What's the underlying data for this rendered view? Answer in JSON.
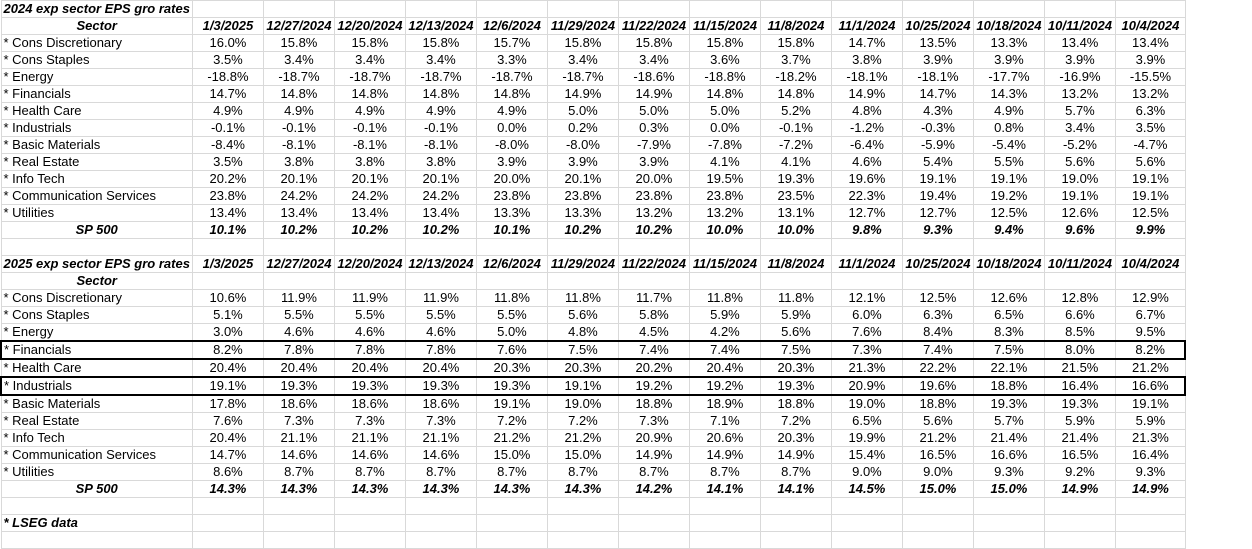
{
  "dates": [
    "1/3/2025",
    "12/27/2024",
    "12/20/2024",
    "12/13/2024",
    "12/6/2024",
    "11/29/2024",
    "11/22/2024",
    "11/15/2024",
    "11/8/2024",
    "11/1/2024",
    "10/25/2024",
    "10/18/2024",
    "10/11/2024",
    "10/4/2024"
  ],
  "section2024": {
    "title": "2024 exp sector EPS gro rates",
    "sector_header": "Sector",
    "rows": [
      {
        "label": "* Cons Discretionary",
        "values": [
          "16.0%",
          "15.8%",
          "15.8%",
          "15.8%",
          "15.7%",
          "15.8%",
          "15.8%",
          "15.8%",
          "15.8%",
          "14.7%",
          "13.5%",
          "13.3%",
          "13.4%",
          "13.4%"
        ]
      },
      {
        "label": "* Cons Staples",
        "values": [
          "3.5%",
          "3.4%",
          "3.4%",
          "3.4%",
          "3.3%",
          "3.4%",
          "3.4%",
          "3.6%",
          "3.7%",
          "3.8%",
          "3.9%",
          "3.9%",
          "3.9%",
          "3.9%"
        ]
      },
      {
        "label": "* Energy",
        "values": [
          "-18.8%",
          "-18.7%",
          "-18.7%",
          "-18.7%",
          "-18.7%",
          "-18.7%",
          "-18.6%",
          "-18.8%",
          "-18.2%",
          "-18.1%",
          "-18.1%",
          "-17.7%",
          "-16.9%",
          "-15.5%"
        ]
      },
      {
        "label": "* Financials",
        "values": [
          "14.7%",
          "14.8%",
          "14.8%",
          "14.8%",
          "14.8%",
          "14.9%",
          "14.9%",
          "14.8%",
          "14.8%",
          "14.9%",
          "14.7%",
          "14.3%",
          "13.2%",
          "13.2%"
        ]
      },
      {
        "label": "* Health Care",
        "values": [
          "4.9%",
          "4.9%",
          "4.9%",
          "4.9%",
          "4.9%",
          "5.0%",
          "5.0%",
          "5.0%",
          "5.2%",
          "4.8%",
          "4.3%",
          "4.9%",
          "5.7%",
          "6.3%"
        ]
      },
      {
        "label": "* Industrials",
        "values": [
          "-0.1%",
          "-0.1%",
          "-0.1%",
          "-0.1%",
          "0.0%",
          "0.2%",
          "0.3%",
          "0.0%",
          "-0.1%",
          "-1.2%",
          "-0.3%",
          "0.8%",
          "3.4%",
          "3.5%"
        ]
      },
      {
        "label": "* Basic Materials",
        "values": [
          "-8.4%",
          "-8.1%",
          "-8.1%",
          "-8.1%",
          "-8.0%",
          "-8.0%",
          "-7.9%",
          "-7.8%",
          "-7.2%",
          "-6.4%",
          "-5.9%",
          "-5.4%",
          "-5.2%",
          "-4.7%"
        ]
      },
      {
        "label": "* Real Estate",
        "values": [
          "3.5%",
          "3.8%",
          "3.8%",
          "3.8%",
          "3.9%",
          "3.9%",
          "3.9%",
          "4.1%",
          "4.1%",
          "4.6%",
          "5.4%",
          "5.5%",
          "5.6%",
          "5.6%"
        ]
      },
      {
        "label": "* Info Tech",
        "values": [
          "20.2%",
          "20.1%",
          "20.1%",
          "20.1%",
          "20.0%",
          "20.1%",
          "20.0%",
          "19.5%",
          "19.3%",
          "19.6%",
          "19.1%",
          "19.1%",
          "19.0%",
          "19.1%"
        ]
      },
      {
        "label": "* Communication Services",
        "values": [
          "23.8%",
          "24.2%",
          "24.2%",
          "24.2%",
          "23.8%",
          "23.8%",
          "23.8%",
          "23.8%",
          "23.5%",
          "22.3%",
          "19.4%",
          "19.2%",
          "19.1%",
          "19.1%"
        ]
      },
      {
        "label": "* Utilities",
        "values": [
          "13.4%",
          "13.4%",
          "13.4%",
          "13.4%",
          "13.3%",
          "13.3%",
          "13.2%",
          "13.2%",
          "13.1%",
          "12.7%",
          "12.7%",
          "12.5%",
          "12.6%",
          "12.5%"
        ]
      }
    ],
    "total": {
      "label": "SP 500",
      "values": [
        "10.1%",
        "10.2%",
        "10.2%",
        "10.2%",
        "10.1%",
        "10.2%",
        "10.2%",
        "10.0%",
        "10.0%",
        "9.8%",
        "9.3%",
        "9.4%",
        "9.6%",
        "9.9%"
      ]
    }
  },
  "section2025": {
    "title": "2025 exp sector EPS gro rates",
    "sector_header": "Sector",
    "rows": [
      {
        "label": "* Cons Discretionary",
        "values": [
          "10.6%",
          "11.9%",
          "11.9%",
          "11.9%",
          "11.8%",
          "11.8%",
          "11.7%",
          "11.8%",
          "11.8%",
          "12.1%",
          "12.5%",
          "12.6%",
          "12.8%",
          "12.9%"
        ]
      },
      {
        "label": "* Cons Staples",
        "values": [
          "5.1%",
          "5.5%",
          "5.5%",
          "5.5%",
          "5.5%",
          "5.6%",
          "5.8%",
          "5.9%",
          "5.9%",
          "6.0%",
          "6.3%",
          "6.5%",
          "6.6%",
          "6.7%"
        ]
      },
      {
        "label": "* Energy",
        "values": [
          "3.0%",
          "4.6%",
          "4.6%",
          "4.6%",
          "5.0%",
          "4.8%",
          "4.5%",
          "4.2%",
          "5.6%",
          "7.6%",
          "8.4%",
          "8.3%",
          "8.5%",
          "9.5%"
        ]
      },
      {
        "label": "* Financials",
        "boxed": true,
        "values": [
          "8.2%",
          "7.8%",
          "7.8%",
          "7.8%",
          "7.6%",
          "7.5%",
          "7.4%",
          "7.4%",
          "7.5%",
          "7.3%",
          "7.4%",
          "7.5%",
          "8.0%",
          "8.2%"
        ]
      },
      {
        "label": "* Health Care",
        "values": [
          "20.4%",
          "20.4%",
          "20.4%",
          "20.4%",
          "20.3%",
          "20.3%",
          "20.2%",
          "20.4%",
          "20.3%",
          "21.3%",
          "22.2%",
          "22.1%",
          "21.5%",
          "21.2%"
        ]
      },
      {
        "label": "* Industrials",
        "boxed": true,
        "values": [
          "19.1%",
          "19.3%",
          "19.3%",
          "19.3%",
          "19.3%",
          "19.1%",
          "19.2%",
          "19.2%",
          "19.3%",
          "20.9%",
          "19.6%",
          "18.8%",
          "16.4%",
          "16.6%"
        ]
      },
      {
        "label": "* Basic Materials",
        "values": [
          "17.8%",
          "18.6%",
          "18.6%",
          "18.6%",
          "19.1%",
          "19.0%",
          "18.8%",
          "18.9%",
          "18.8%",
          "19.0%",
          "18.8%",
          "19.3%",
          "19.3%",
          "19.1%"
        ]
      },
      {
        "label": "* Real Estate",
        "values": [
          "7.6%",
          "7.3%",
          "7.3%",
          "7.3%",
          "7.2%",
          "7.2%",
          "7.3%",
          "7.1%",
          "7.2%",
          "6.5%",
          "5.6%",
          "5.7%",
          "5.9%",
          "5.9%"
        ]
      },
      {
        "label": "* Info Tech",
        "values": [
          "20.4%",
          "21.1%",
          "21.1%",
          "21.1%",
          "21.2%",
          "21.2%",
          "20.9%",
          "20.6%",
          "20.3%",
          "19.9%",
          "21.2%",
          "21.4%",
          "21.4%",
          "21.3%"
        ]
      },
      {
        "label": "* Communication Services",
        "values": [
          "14.7%",
          "14.6%",
          "14.6%",
          "14.6%",
          "15.0%",
          "15.0%",
          "14.9%",
          "14.9%",
          "14.9%",
          "15.4%",
          "16.5%",
          "16.6%",
          "16.5%",
          "16.4%"
        ]
      },
      {
        "label": "* Utilities",
        "values": [
          "8.6%",
          "8.7%",
          "8.7%",
          "8.7%",
          "8.7%",
          "8.7%",
          "8.7%",
          "8.7%",
          "8.7%",
          "9.0%",
          "9.0%",
          "9.3%",
          "9.2%",
          "9.3%"
        ]
      }
    ],
    "total": {
      "label": "SP 500",
      "values": [
        "14.3%",
        "14.3%",
        "14.3%",
        "14.3%",
        "14.3%",
        "14.3%",
        "14.2%",
        "14.1%",
        "14.1%",
        "14.5%",
        "15.0%",
        "15.0%",
        "14.9%",
        "14.9%"
      ]
    }
  },
  "footnote": "* LSEG data"
}
